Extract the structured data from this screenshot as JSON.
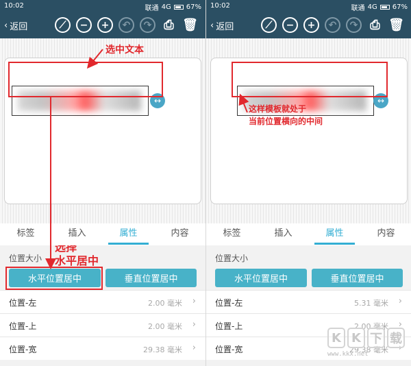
{
  "status": {
    "time": "10:02",
    "carrier": "联通",
    "network": "4G",
    "battery": "67%"
  },
  "toolbar": {
    "back_label": "返回"
  },
  "tabs": [
    "标签",
    "插入",
    "属性",
    "内容"
  ],
  "properties": {
    "section_label": "位置大小",
    "h_center_button": "水平位置居中",
    "v_center_button": "垂直位置居中"
  },
  "left": {
    "rows": [
      {
        "name": "位置-左",
        "value": "2.00 毫米"
      },
      {
        "name": "位置-上",
        "value": "2.00 毫米"
      },
      {
        "name": "位置-宽",
        "value": "29.38 毫米"
      }
    ],
    "annotations": {
      "select_text": "选中文本",
      "choose_line1": "选择",
      "choose_line2": "水平居中"
    }
  },
  "right": {
    "rows": [
      {
        "name": "位置-左",
        "value": "5.31 毫米"
      },
      {
        "name": "位置-上",
        "value": "2.00 毫米"
      },
      {
        "name": "位置-宽",
        "value": "29.38 毫米"
      }
    ],
    "annotations": {
      "line1": "这样模板就处于",
      "line2": "当前位置横向的中间"
    }
  },
  "watermark": {
    "letters": [
      "K",
      "K",
      "下",
      "载"
    ],
    "url": "www.kkx.net"
  },
  "colors": {
    "header": "#2b4f63",
    "accent": "#33aed3",
    "button": "#48b2c8",
    "annotation": "#e1282d"
  }
}
